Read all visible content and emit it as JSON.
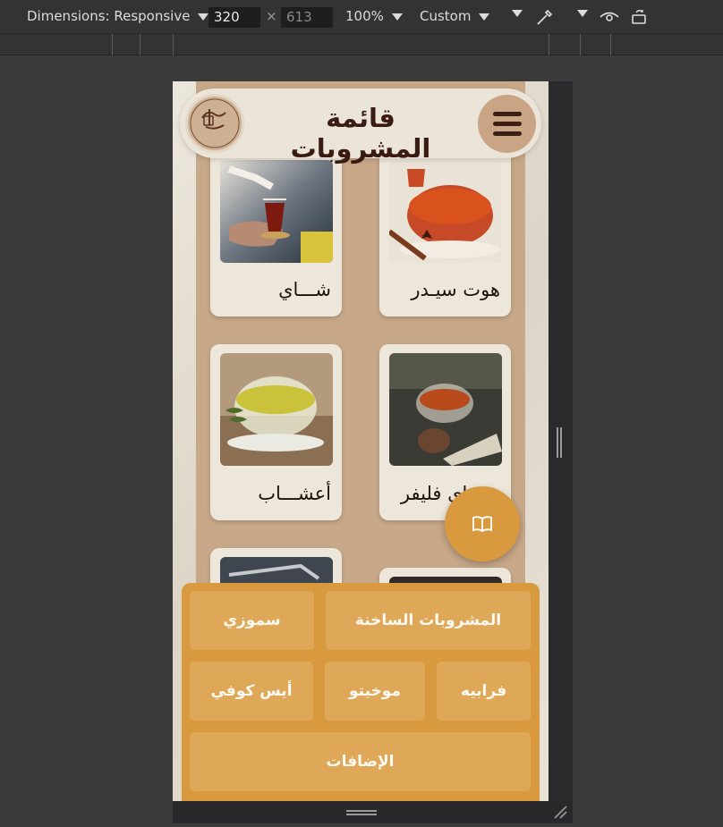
{
  "devtools": {
    "dimensions_label": "Dimensions: Responsive",
    "width_value": "320",
    "times": "×",
    "height_value": "613",
    "zoom": "100%",
    "throttle": "Custom"
  },
  "app": {
    "title": "قائمة المشروبات",
    "logo_text": "ALLAM COFFEE"
  },
  "cards": [
    {
      "label": "شـــاي",
      "image": "tea-glass"
    },
    {
      "label": "هوت سيـدر",
      "image": "hot-cider"
    },
    {
      "label": "أعشـــاب",
      "image": "herbal-tea"
    },
    {
      "label": "شـــاي فليفر",
      "image": "flavored-tea"
    }
  ],
  "categories": [
    {
      "label": "المشروبات الساخنة"
    },
    {
      "label": "سموزي"
    },
    {
      "label": "فرابيه"
    },
    {
      "label": "موخيتو"
    },
    {
      "label": "أيس كوفي"
    },
    {
      "label": "الإضافات"
    }
  ],
  "colors": {
    "accent": "#d9993e",
    "panel": "#c7a888",
    "title": "#3a1b12"
  },
  "icons": {
    "fab": "book-icon",
    "menu": "hamburger-icon"
  }
}
